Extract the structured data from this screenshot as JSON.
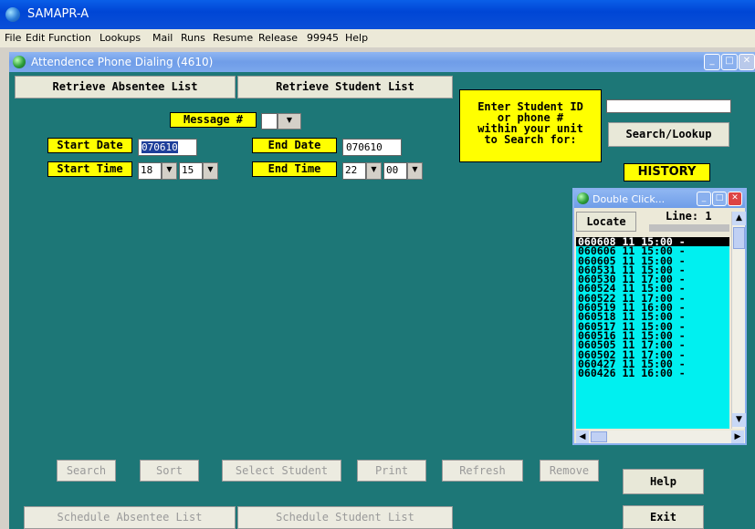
{
  "app": {
    "title": "SAMAPR-A"
  },
  "menu": [
    "File",
    "Edit",
    "Function",
    "Lookups",
    "Mail",
    "Runs",
    "Resume",
    "Release",
    "99945",
    "Help"
  ],
  "window": {
    "title": "Attendence Phone Dialing (4610)"
  },
  "top_buttons": {
    "retrieve_absentee": "Retrieve Absentee List",
    "retrieve_student": "Retrieve Student List"
  },
  "form": {
    "message_label": "Message #",
    "message_value": "",
    "start_date_label": "Start Date",
    "start_date_value": "070610",
    "end_date_label": "End Date",
    "end_date_value": "070610",
    "start_time_label": "Start Time",
    "start_hour": "18",
    "start_min": "15",
    "end_time_label": "End Time",
    "end_hour": "22",
    "end_min": "00"
  },
  "search": {
    "prompt_lines": [
      "Enter Student ID",
      "or phone #",
      "within your unit",
      "to Search for:"
    ],
    "input_value": "",
    "button_label": "Search/Lookup"
  },
  "history": {
    "label": "HISTORY",
    "popup_title": "Double Click...",
    "locate_label": "Locate",
    "line_label": "Line:",
    "line_value": "1",
    "rows": [
      "060608 11 15:00 -",
      "060606 11 15:00 -",
      "060605 11 15:00 -",
      "060531 11 15:00 -",
      "060530 11 17:00 -",
      "060524 11 15:00 -",
      "060522 11 17:00 -",
      "060519 11 16:00 -",
      "060518 11 15:00 -",
      "060517 11 15:00 -",
      "060516 11 15:00 -",
      "060505 11 17:00 -",
      "060502 11 17:00 -",
      "060427 11 15:00 -",
      "060426 11 16:00 -"
    ],
    "selected_index": 0
  },
  "bottom_buttons": {
    "search": "Search",
    "sort": "Sort",
    "select_student": "Select Student",
    "print": "Print",
    "refresh": "Refresh",
    "remove": "Remove",
    "help": "Help",
    "schedule_absentee": "Schedule Absentee List",
    "schedule_student": "Schedule Student List",
    "exit": "Exit"
  },
  "colors": {
    "client_bg": "#1d7777",
    "label_bg": "#ffff00",
    "list_bg": "#00f0f0",
    "title_blue": "#0046d5"
  }
}
